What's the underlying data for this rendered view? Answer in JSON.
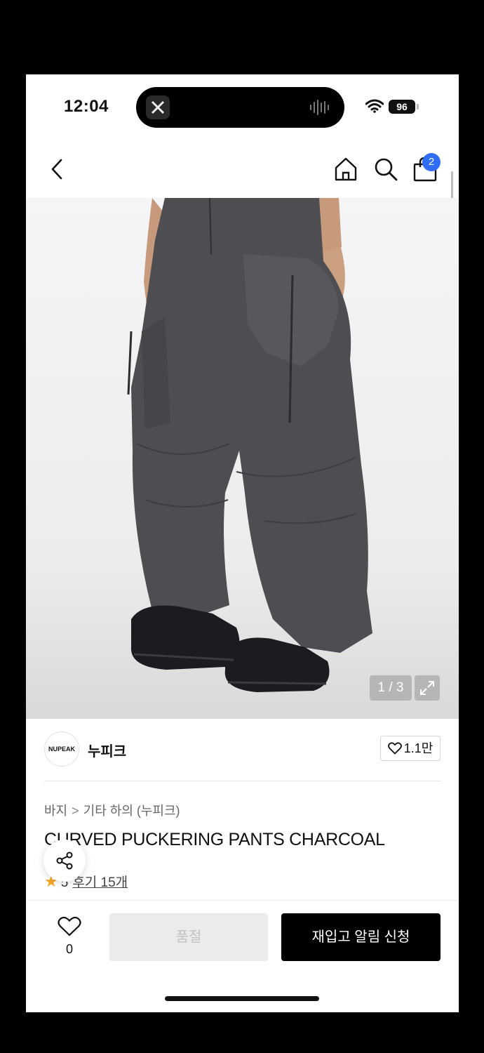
{
  "status_bar": {
    "time": "12:04",
    "battery": "96"
  },
  "nav": {
    "cart_count": "2"
  },
  "gallery": {
    "counter": "1 / 3"
  },
  "brand": {
    "logo_text": "NUPEAK",
    "name": "누피크",
    "likes": "1.1만"
  },
  "breadcrumb": {
    "category": "바지",
    "separator": ">",
    "subcategory": "기타 하의 (누피크)"
  },
  "product": {
    "title": "CURVED PUCKERING PANTS CHARCOAL",
    "rating": "5",
    "reviews": "후기 15개"
  },
  "bottom_bar": {
    "wish_count": "0",
    "soldout_label": "품절",
    "restock_label": "재입고 알림 신청"
  },
  "colors": {
    "accent": "#2f6df6",
    "star": "#f5a623",
    "primary_button": "#000000",
    "disabled_button": "#ebebeb"
  },
  "icons": [
    "back-icon",
    "home-icon",
    "search-icon",
    "shopping-bag-icon",
    "expand-icon",
    "heart-icon",
    "share-icon",
    "star-icon",
    "wifi-icon"
  ]
}
